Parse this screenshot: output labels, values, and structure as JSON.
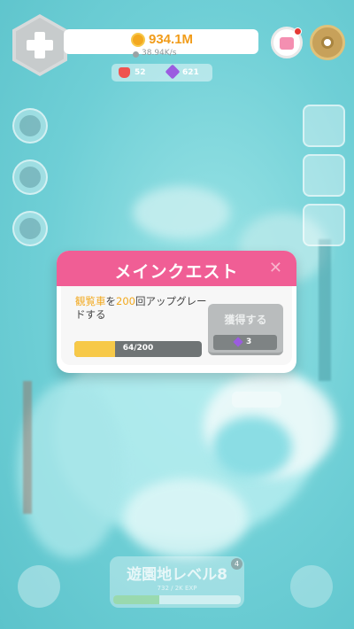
{
  "hud": {
    "coins": "934.1M",
    "coin_rate": "38.94K/s",
    "hearts": "52",
    "gems": "621"
  },
  "quest": {
    "title": "メインクエスト",
    "close_label": "✕",
    "text_part1": "観覧車",
    "text_part2": "を",
    "text_part3": "200",
    "text_part4": "回アップグレードする",
    "progress_label": "64/200",
    "progress_fraction": 0.32,
    "claim_label": "獲得する",
    "reward_gems": "3"
  },
  "level": {
    "title": "遊園地レベル8",
    "badge": "4",
    "exp_label": "732 / 2K EXP",
    "exp_fraction": 0.36
  },
  "colors": {
    "quest_header": "#f05e95",
    "coin_orange": "#f19c1a",
    "progress_yellow": "#f7c948",
    "gem_purple": "#9b5ce0"
  },
  "icons": [
    "plus-icon",
    "coin-icon",
    "heart-icon",
    "gem-icon",
    "shop-bag-icon",
    "gear-icon"
  ]
}
